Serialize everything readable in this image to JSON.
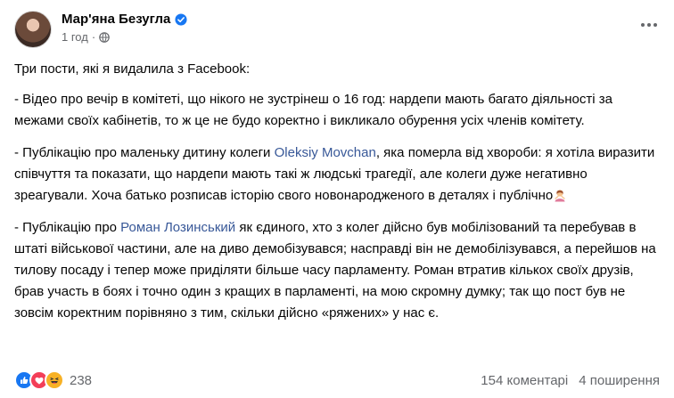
{
  "post": {
    "author": "Мар'яна Безугла",
    "time": "1 год",
    "separator": "·",
    "intro": "Три пости, які я видалила з Facebook:",
    "bullet1": " - Відео про вечір в комітеті, що нікого не зустрінеш о 16 год: нардепи мають багато діяльності за межами своїх кабінетів, то ж це не будо коректно і викликало обурення усіх членів комітету.",
    "bullet2_pre": " - Публікацію про маленьку дитину колеги ",
    "bullet2_link": "Oleksiy Movchan",
    "bullet2_post": ", яка померла від хвороби: я хотіла виразити співчуття та показати, що нардепи мають такі ж людські трагедії, але колеги дуже негативно зреагували. Хоча батько розписав історію свого новонародженого в деталях і публічно",
    "bullet3_pre": " - Публікацію про ",
    "bullet3_link": "Роман Лозинський",
    "bullet3_post": " як єдиного, хто з колег дійсно був мобілізований та перебував в штаті військової частини, але на диво демобізувався; насправді він не демобілізувався, а перейшов на тилову посаду і тепер може приділяти більше часу парламенту. Роман втратив кількох своїх друзів, брав участь в боях і точно один з кращих в парламенті, на мою скромну думку; так що пост був не зовсім коректним порівняно з тим, скільки дійсно «ряжених» у нас є."
  },
  "footer": {
    "reactions_count": "238",
    "comments": "154 коментарі",
    "shares": "4 поширення"
  },
  "icons": {
    "verified": "verified-badge-icon",
    "globe": "globe-icon",
    "more": "more-options-icon",
    "emoji": "person-gesturing-emoji",
    "like": "like-reaction-icon",
    "love": "love-reaction-icon",
    "haha": "haha-reaction-icon"
  },
  "colors": {
    "link": "#385898",
    "like": "#1877f2",
    "love": "#f33e58",
    "haha": "#f7b125",
    "secondary_text": "#65676b"
  }
}
